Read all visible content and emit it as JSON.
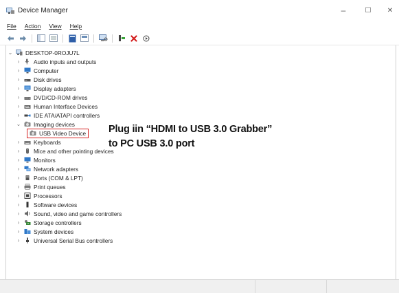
{
  "window": {
    "title": "Device Manager",
    "controls": {
      "minimize": "–",
      "maximize": "☐",
      "close": "✕"
    }
  },
  "menu": [
    "File",
    "Action",
    "View",
    "Help"
  ],
  "toolbar": {
    "icons": [
      "back-arrow-icon",
      "forward-arrow-icon",
      "show-hide-console-tree-icon",
      "help-icon",
      "properties-icon",
      "update-driver-icon",
      "scan-hardware-icon",
      "enable-device-icon",
      "uninstall-device-icon",
      "disable-device-icon"
    ]
  },
  "tree": {
    "root": "DESKTOP-0ROJU7L",
    "items": [
      "Audio inputs and outputs",
      "Computer",
      "Disk drives",
      "Display adapters",
      "DVD/CD-ROM drives",
      "Human Interface Devices",
      "IDE ATA/ATAPI controllers",
      "Imaging devices",
      "USB Video Device",
      "Keyboards",
      "Mice and other pointing devices",
      "Monitors",
      "Network adapters",
      "Ports (COM & LPT)",
      "Print queues",
      "Processors",
      "Software devices",
      "Sound, video and game controllers",
      "Storage controllers",
      "System devices",
      "Universal Serial Bus controllers"
    ]
  },
  "annotation": {
    "line1": "Plug iin “HDMI to USB 3.0 Grabber”",
    "line2": "to PC USB 3.0 port"
  },
  "colors": {
    "highlight_box": "#d62020",
    "folder_blue": "#2f78c8"
  }
}
